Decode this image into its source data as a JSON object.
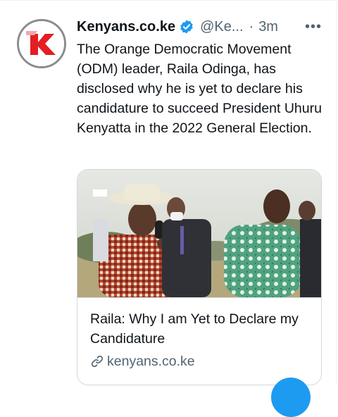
{
  "tweet": {
    "display_name": "Kenyans.co.ke",
    "handle": "@Ke...",
    "separator": "·",
    "timestamp": "3m",
    "more_label": "•••",
    "text": "The Orange Democratic Movement (ODM) leader, Raila Odinga, has disclosed why he is yet to declare his candidature to succeed President Uhuru Kenyatta in the 2022 General Election."
  },
  "card": {
    "title": "Raila: Why I am Yet to Declare my Candidature",
    "domain": "kenyans.co.ke"
  },
  "icons": {
    "avatar": "kenyans-k-logo",
    "verified": "verified-badge-icon",
    "link": "link-icon",
    "more": "more-options-icon"
  },
  "colors": {
    "accent": "#1d9bf0",
    "logo_red": "#e31e24",
    "secondary_text": "#536471",
    "border": "#cfd9de"
  }
}
